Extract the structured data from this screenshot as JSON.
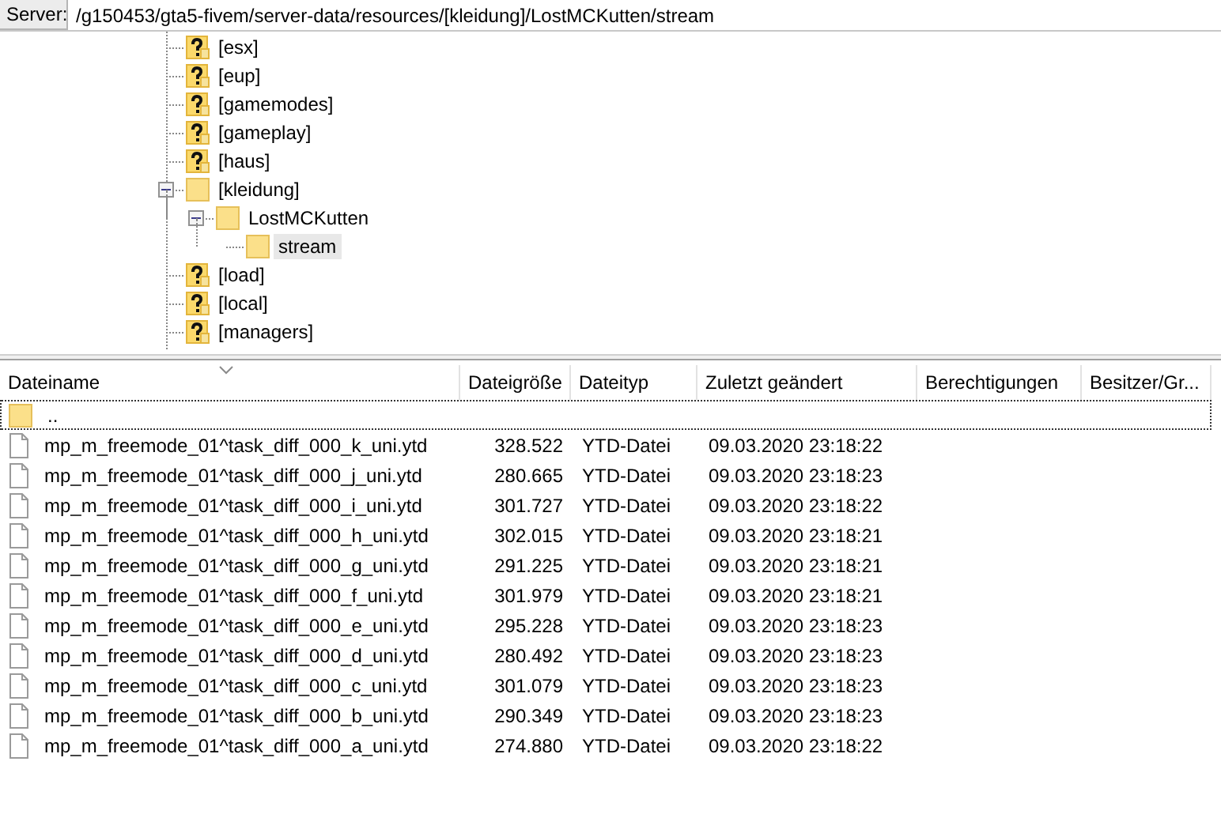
{
  "server_bar": {
    "label": "Server:",
    "path": "/g150453/gta5-fivem/server-data/resources/[kleidung]/LostMCKutten/stream"
  },
  "tree": [
    {
      "label": "[esx]",
      "kind": "unknown",
      "selected": false
    },
    {
      "label": "[eup]",
      "kind": "unknown",
      "selected": false
    },
    {
      "label": "[gamemodes]",
      "kind": "unknown",
      "selected": false
    },
    {
      "label": "[gameplay]",
      "kind": "unknown",
      "selected": false
    },
    {
      "label": "[haus]",
      "kind": "unknown",
      "selected": false
    },
    {
      "label": "[kleidung]",
      "kind": "folder",
      "expanded": true,
      "selected": false,
      "children": [
        {
          "label": "LostMCKutten",
          "kind": "folder",
          "expanded": true,
          "selected": false,
          "children": [
            {
              "label": "stream",
              "kind": "folder",
              "selected": true
            }
          ]
        }
      ]
    },
    {
      "label": "[load]",
      "kind": "unknown",
      "selected": false
    },
    {
      "label": "[local]",
      "kind": "unknown",
      "selected": false
    },
    {
      "label": "[managers]",
      "kind": "unknown",
      "selected": false
    }
  ],
  "table": {
    "columns": [
      "Dateiname",
      "Dateigröße",
      "Dateityp",
      "Zuletzt geändert",
      "Berechtigungen",
      "Besitzer/Gr..."
    ],
    "rows": [
      {
        "kind": "folder",
        "name": "..",
        "focused": true
      },
      {
        "kind": "file",
        "name": "mp_m_freemode_01^task_diff_000_k_uni.ytd",
        "size": "328.522",
        "type": "YTD-Datei",
        "modified": "09.03.2020 23:18:22",
        "focused": false
      },
      {
        "kind": "file",
        "name": "mp_m_freemode_01^task_diff_000_j_uni.ytd",
        "size": "280.665",
        "type": "YTD-Datei",
        "modified": "09.03.2020 23:18:23",
        "focused": false
      },
      {
        "kind": "file",
        "name": "mp_m_freemode_01^task_diff_000_i_uni.ytd",
        "size": "301.727",
        "type": "YTD-Datei",
        "modified": "09.03.2020 23:18:22",
        "focused": false
      },
      {
        "kind": "file",
        "name": "mp_m_freemode_01^task_diff_000_h_uni.ytd",
        "size": "302.015",
        "type": "YTD-Datei",
        "modified": "09.03.2020 23:18:21",
        "focused": false
      },
      {
        "kind": "file",
        "name": "mp_m_freemode_01^task_diff_000_g_uni.ytd",
        "size": "291.225",
        "type": "YTD-Datei",
        "modified": "09.03.2020 23:18:21",
        "focused": false
      },
      {
        "kind": "file",
        "name": "mp_m_freemode_01^task_diff_000_f_uni.ytd",
        "size": "301.979",
        "type": "YTD-Datei",
        "modified": "09.03.2020 23:18:21",
        "focused": false
      },
      {
        "kind": "file",
        "name": "mp_m_freemode_01^task_diff_000_e_uni.ytd",
        "size": "295.228",
        "type": "YTD-Datei",
        "modified": "09.03.2020 23:18:23",
        "focused": false
      },
      {
        "kind": "file",
        "name": "mp_m_freemode_01^task_diff_000_d_uni.ytd",
        "size": "280.492",
        "type": "YTD-Datei",
        "modified": "09.03.2020 23:18:23",
        "focused": false
      },
      {
        "kind": "file",
        "name": "mp_m_freemode_01^task_diff_000_c_uni.ytd",
        "size": "301.079",
        "type": "YTD-Datei",
        "modified": "09.03.2020 23:18:23",
        "focused": false
      },
      {
        "kind": "file",
        "name": "mp_m_freemode_01^task_diff_000_b_uni.ytd",
        "size": "290.349",
        "type": "YTD-Datei",
        "modified": "09.03.2020 23:18:23",
        "focused": false
      },
      {
        "kind": "file",
        "name": "mp_m_freemode_01^task_diff_000_a_uni.ytd",
        "size": "274.880",
        "type": "YTD-Datei",
        "modified": "09.03.2020 23:18:22",
        "focused": false
      }
    ]
  }
}
